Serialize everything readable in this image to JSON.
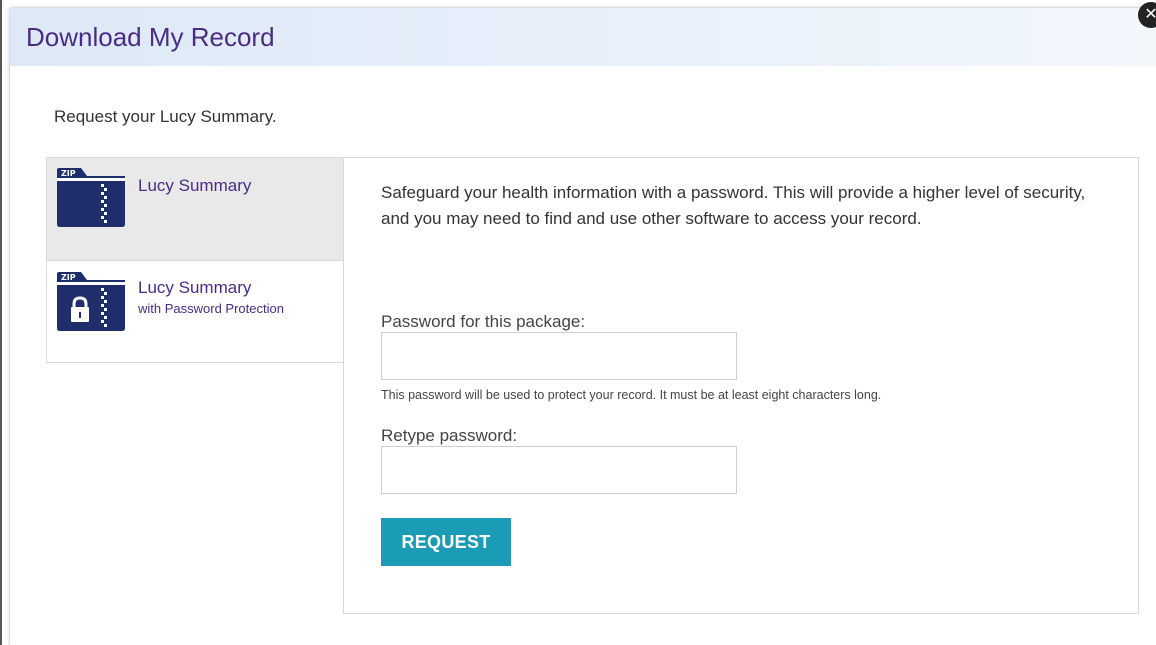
{
  "dialog": {
    "title": "Download My Record",
    "close_symbol": "✕"
  },
  "intro": "Request your Lucy Summary.",
  "tabs": [
    {
      "label": "Lucy Summary",
      "sublabel": "",
      "icon": "zip-folder-icon",
      "zip_text": "ZIP",
      "selected": false
    },
    {
      "label": "Lucy Summary",
      "sublabel": "with Password Protection",
      "icon": "zip-folder-lock-icon",
      "zip_text": "ZIP",
      "selected": true
    }
  ],
  "panel": {
    "description": "Safeguard your health information with a password. This will provide a higher level of security, and you may need to find and use other software to access your record.",
    "password_label": "Password for this package:",
    "password_value": "",
    "password_hint": "This password will be used to protect your record. It must be at least eight characters long.",
    "retype_label": "Retype password:",
    "retype_value": "",
    "request_label": "REQUEST"
  },
  "colors": {
    "accent_purple": "#4b2b84",
    "button_teal": "#1a9cb6",
    "icon_navy": "#1f2d6b"
  }
}
